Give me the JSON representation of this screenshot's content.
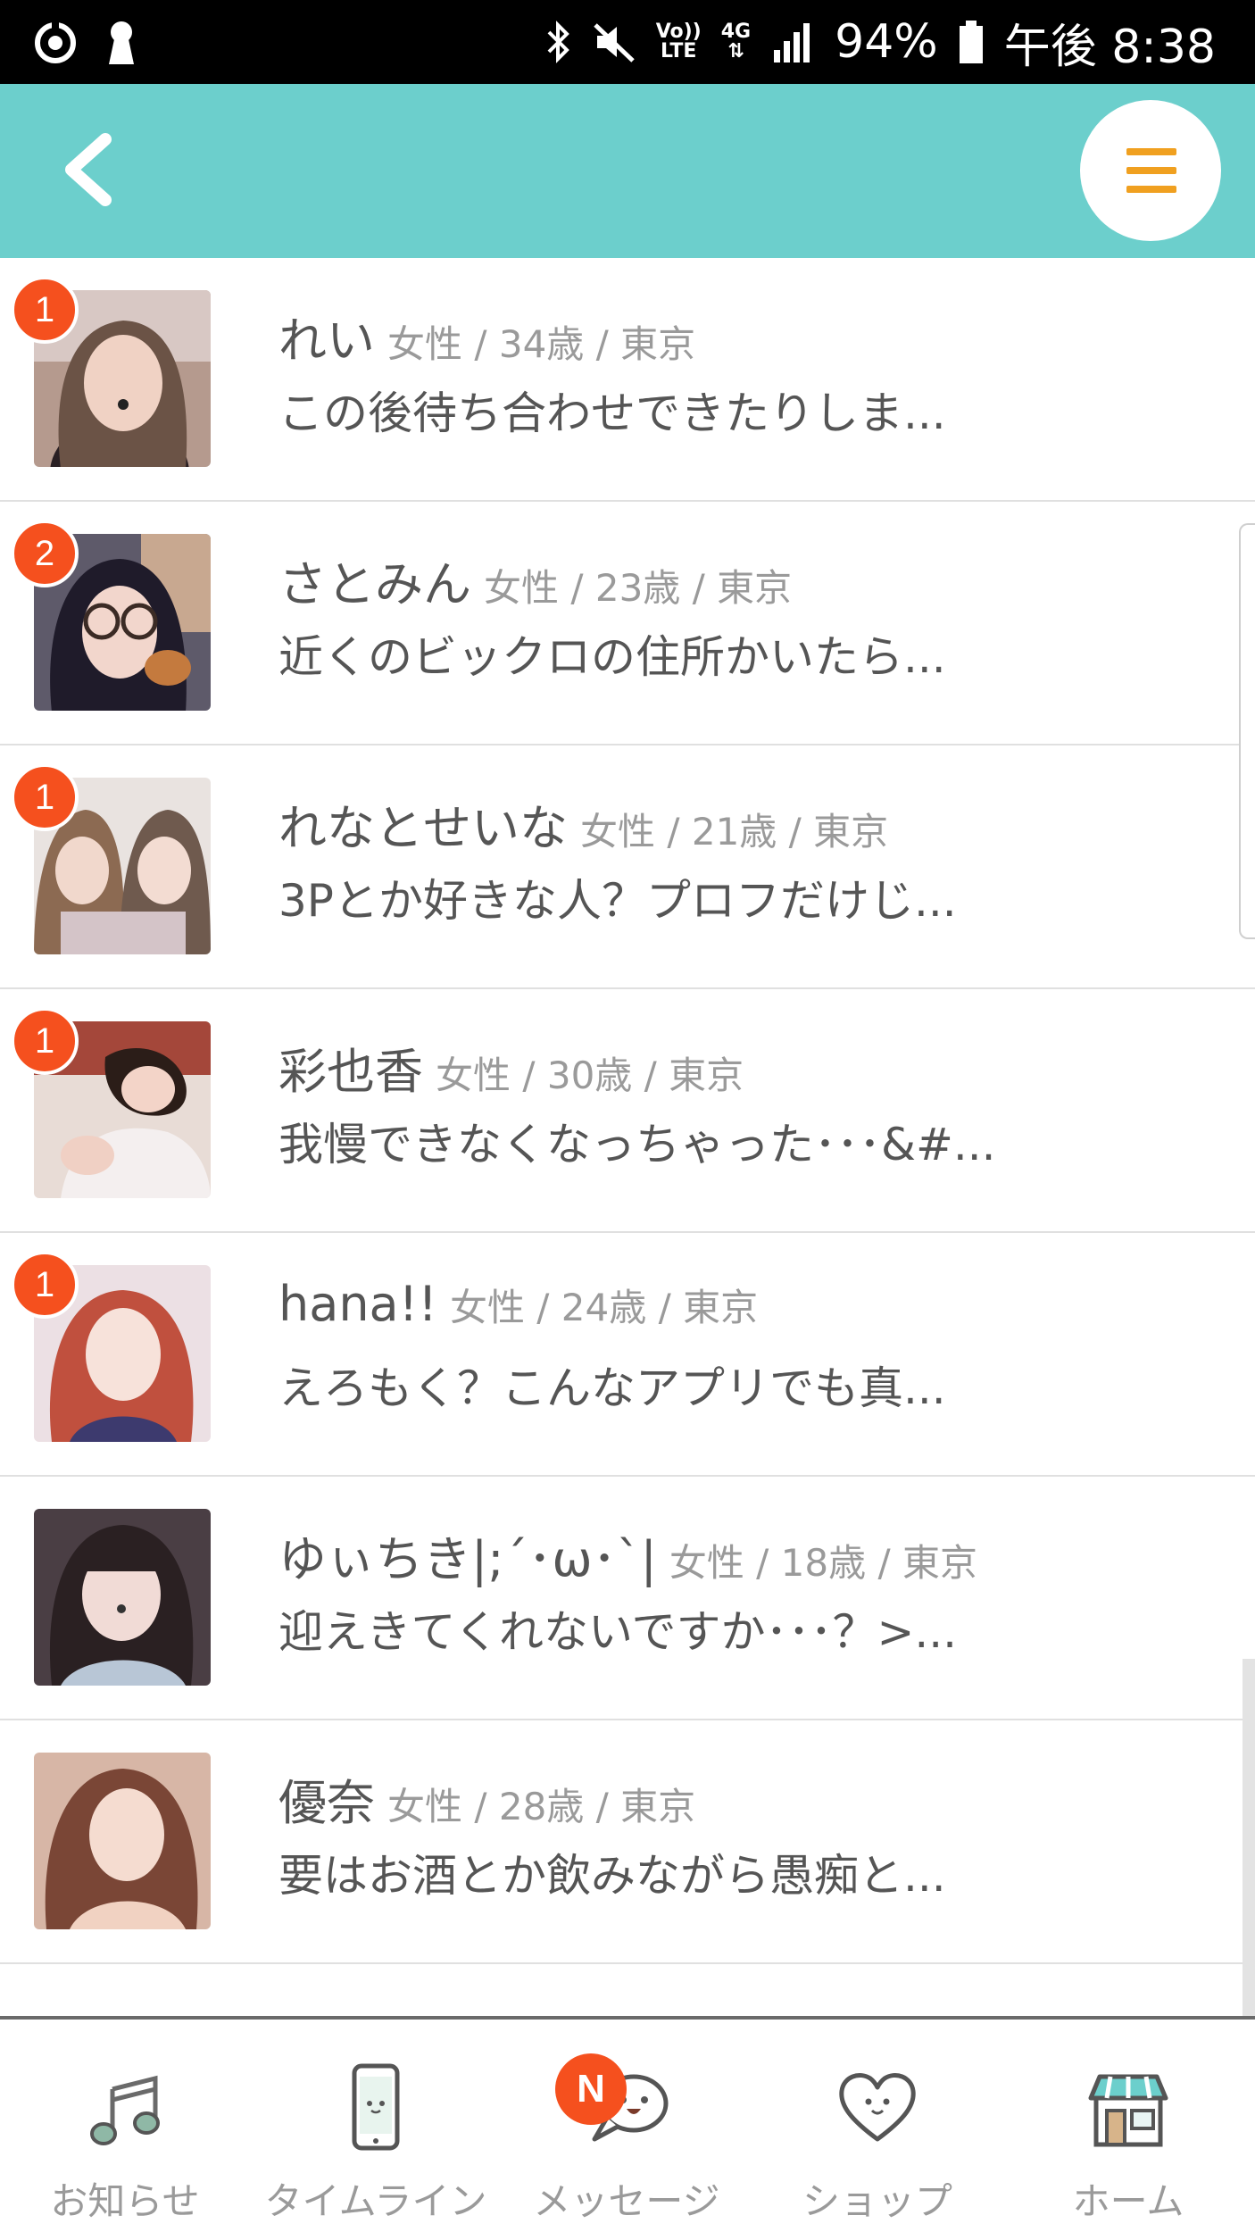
{
  "status_bar": {
    "volte_line1": "Vo))",
    "volte_line2": "LTE",
    "network": "4G",
    "battery": "94%",
    "time": "午後 8:38"
  },
  "header": {
    "back_icon": "chevron-left-icon",
    "menu_icon": "hamburger-menu-icon",
    "accent_color": "#6ccfcc",
    "menu_color": "#f0a020"
  },
  "conversations": [
    {
      "badge": "1",
      "name": "れい",
      "meta": "女性 / 34歳 / 東京",
      "preview": "この後待ち合わせできたりしま..."
    },
    {
      "badge": "2",
      "name": "さとみん",
      "meta": "女性 / 23歳 / 東京",
      "preview": "近くのビックロの住所かいたら..."
    },
    {
      "badge": "1",
      "name": "れなとせいな",
      "meta": "女性 / 21歳 / 東京",
      "preview": "3Pとか好きな人？プロフだけじ..."
    },
    {
      "badge": "1",
      "name": "彩也香",
      "meta": "女性 / 30歳 / 東京",
      "preview": "我慢できなくなっちゃった･･･&#..."
    },
    {
      "badge": "1",
      "name": "hana!!",
      "meta": "女性 / 24歳 / 東京",
      "preview": "えろもく？こんなアプリでも真..."
    },
    {
      "badge": "",
      "name": "ゆぃちき|;´･ω･`|",
      "meta": "女性 / 18歳 / 東京",
      "preview": "迎えきてくれないですか･･･？>..."
    },
    {
      "badge": "",
      "name": "優奈",
      "meta": "女性 / 28歳 / 東京",
      "preview": "要はお酒とか飲みながら愚痴と..."
    }
  ],
  "bottom_nav": [
    {
      "label": "お知らせ",
      "icon": "music-note-icon"
    },
    {
      "label": "タイムライン",
      "icon": "smartphone-icon"
    },
    {
      "label": "メッセージ",
      "icon": "chat-bubble-icon",
      "badge": "N"
    },
    {
      "label": "ショップ",
      "icon": "heart-icon"
    },
    {
      "label": "ホーム",
      "icon": "shop-icon"
    }
  ],
  "badge_color": "#f5501e"
}
